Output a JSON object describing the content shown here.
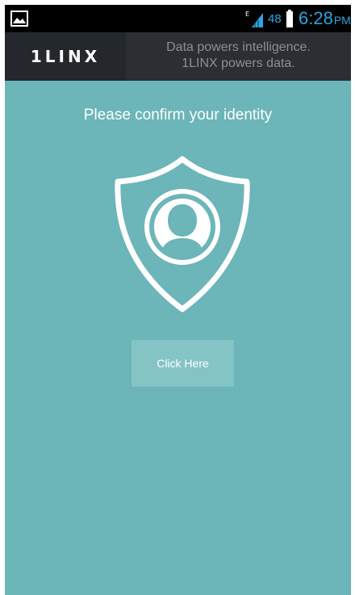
{
  "status_bar": {
    "icons": [
      "gallery-icon",
      "signal-icon",
      "battery-icon"
    ],
    "network_type": "E",
    "battery_percent": "48",
    "time": "6:28",
    "ampm": "PM",
    "text_color": "#2aa6e0"
  },
  "header": {
    "brand": "1LINX",
    "tagline_line1": "Data powers intelligence.",
    "tagline_line2": "1LINX powers data."
  },
  "main": {
    "prompt": "Please confirm your identity",
    "shield_icon": "shield-user-icon",
    "button_label": "Click Here",
    "background_color": "#6cb5b8"
  }
}
